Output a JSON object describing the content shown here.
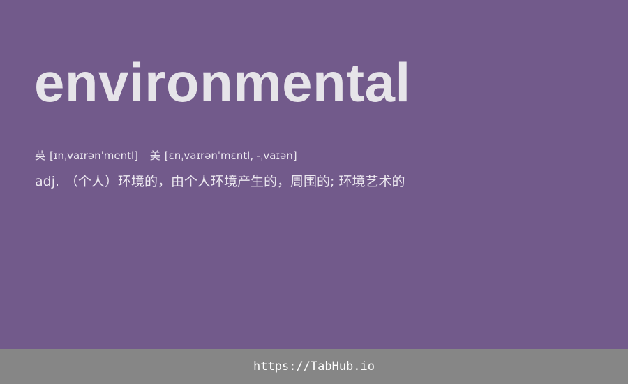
{
  "entry": {
    "word": "environmental",
    "phonetics": {
      "uk_label": "英",
      "uk": "[ɪnˌvaɪrənˈmentl]",
      "us_label": "美",
      "us": "[ɛnˌvaɪrənˈmɛntl, -ˌvaɪən]"
    },
    "definition": {
      "pos": "adj.",
      "text": "（个人）环境的，由个人环境产生的，周围的; 环境艺术的"
    }
  },
  "footer": {
    "link_text": "https://TabHub.io"
  },
  "colors": {
    "background": "#725a8b",
    "footer_background": "#868686",
    "word": "#e6e4e9",
    "text": "#ebe7ef"
  }
}
